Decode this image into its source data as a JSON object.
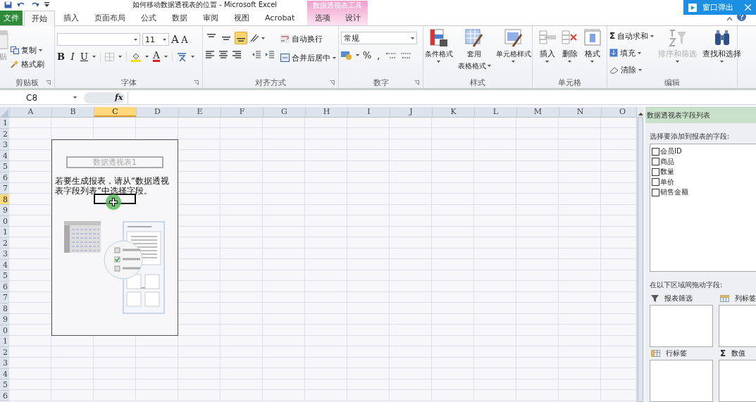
{
  "window": {
    "title": "如何移动数据透视表的位置 - Microsoft Excel"
  },
  "popout_button": {
    "label": "窗口弹出"
  },
  "contextual_group": {
    "label": "数据透视表工具"
  },
  "tabs": [
    {
      "label": "文件",
      "kind": "file",
      "selected": false
    },
    {
      "label": "开始",
      "kind": "normal",
      "selected": true
    },
    {
      "label": "插入",
      "kind": "normal",
      "selected": false
    },
    {
      "label": "页面布局",
      "kind": "normal",
      "selected": false
    },
    {
      "label": "公式",
      "kind": "normal",
      "selected": false
    },
    {
      "label": "数据",
      "kind": "normal",
      "selected": false
    },
    {
      "label": "审阅",
      "kind": "normal",
      "selected": false
    },
    {
      "label": "视图",
      "kind": "normal",
      "selected": false
    },
    {
      "label": "Acrobat",
      "kind": "normal",
      "selected": false
    },
    {
      "label": "选项",
      "kind": "contextual",
      "selected": false
    },
    {
      "label": "设计",
      "kind": "contextual",
      "selected": false
    }
  ],
  "ribbon": {
    "clipboard": {
      "label": "剪贴板",
      "paste": {
        "label": "贴",
        "disabled": true
      },
      "copy": "复制",
      "format_painter": "格式刷"
    },
    "font": {
      "label": "字体",
      "size": "11",
      "grow": "A",
      "shrink": "A",
      "bold": "B",
      "italic": "I",
      "underline": "U",
      "font_color": "A"
    },
    "alignment": {
      "label": "对齐方式",
      "vertical": [
        {
          "selected": false
        },
        {
          "selected": false
        },
        {
          "selected": true
        }
      ],
      "wrap_text": "自动换行",
      "merge_center": "合并后居中"
    },
    "number": {
      "label": "数字",
      "format": "常规",
      "percent": "%",
      "comma": ","
    },
    "styles": {
      "label": "样式",
      "buttons": [
        {
          "lines": [
            "条件格式"
          ],
          "kind": "conditional"
        },
        {
          "lines": [
            "套用",
            "表格格式"
          ],
          "kind": "table"
        },
        {
          "lines": [
            "单元格样式"
          ],
          "kind": "cell"
        }
      ]
    },
    "cells": {
      "label": "单元格",
      "buttons": [
        {
          "label": "插入",
          "kind": "insert"
        },
        {
          "label": "删除",
          "kind": "delete"
        },
        {
          "label": "格式",
          "kind": "format"
        }
      ]
    },
    "editing": {
      "label": "编辑",
      "sigma": "Σ",
      "autosum": "自动求和",
      "fill": "填充",
      "clear": "清除",
      "sort_filter": {
        "label": "排序和筛选",
        "disabled": true
      },
      "find_select": {
        "label": "查找和选择",
        "disabled": false
      }
    }
  },
  "formula_bar": {
    "name_box": "C8",
    "function_label": "fx"
  },
  "sheet": {
    "columns": [
      {
        "label": "A",
        "selected": false
      },
      {
        "label": "B",
        "selected": false
      },
      {
        "label": "C",
        "selected": true
      },
      {
        "label": "D",
        "selected": false
      },
      {
        "label": "E",
        "selected": false
      },
      {
        "label": "F",
        "selected": false
      },
      {
        "label": "G",
        "selected": false
      },
      {
        "label": "H",
        "selected": false
      },
      {
        "label": "I",
        "selected": false
      },
      {
        "label": "J",
        "selected": false
      },
      {
        "label": "K",
        "selected": false
      },
      {
        "label": "L",
        "selected": false
      },
      {
        "label": "M",
        "selected": false
      },
      {
        "label": "N",
        "selected": false
      },
      {
        "label": "O",
        "selected": false
      }
    ],
    "rows": [
      {
        "label": "1",
        "selected": false
      },
      {
        "label": "2",
        "selected": false
      },
      {
        "label": "3",
        "selected": false
      },
      {
        "label": "4",
        "selected": false
      },
      {
        "label": "5",
        "selected": false
      },
      {
        "label": "6",
        "selected": false
      },
      {
        "label": "7",
        "selected": false
      },
      {
        "label": "8",
        "selected": true
      },
      {
        "label": "9",
        "selected": false
      },
      {
        "label": "0",
        "selected": false
      },
      {
        "label": "1",
        "selected": false
      },
      {
        "label": "2",
        "selected": false
      },
      {
        "label": "3",
        "selected": false
      },
      {
        "label": "4",
        "selected": false
      },
      {
        "label": "5",
        "selected": false
      },
      {
        "label": "6",
        "selected": false
      },
      {
        "label": "7",
        "selected": false
      },
      {
        "label": "8",
        "selected": false
      },
      {
        "label": "9",
        "selected": false
      },
      {
        "label": "0",
        "selected": false
      },
      {
        "label": "1",
        "selected": false
      },
      {
        "label": "2",
        "selected": false
      },
      {
        "label": "3",
        "selected": false
      },
      {
        "label": "4",
        "selected": false
      },
      {
        "label": "5",
        "selected": false
      },
      {
        "label": "6",
        "selected": false
      }
    ],
    "pivot_placeholder": {
      "title": "数据透视表1",
      "message": "若要生成报表，请从“数据透视表字段列表”中选择字段。"
    }
  },
  "field_list": {
    "title": "数据透视表字段列表",
    "prompt": "选择要添加到报表的字段:",
    "fields": [
      {
        "label": "会员ID",
        "checked": false
      },
      {
        "label": "商品",
        "checked": false
      },
      {
        "label": "数量",
        "checked": false
      },
      {
        "label": "单价",
        "checked": false
      },
      {
        "label": "销售金额",
        "checked": false
      }
    ],
    "areas_prompt": "在以下区域间拖动字段:",
    "areas": [
      {
        "label": "报表筛选",
        "kind": "filter"
      },
      {
        "label": "列标签",
        "kind": "columns"
      },
      {
        "label": "行标签",
        "kind": "rows"
      },
      {
        "label": "数值",
        "kind": "values",
        "symbol": "Σ"
      }
    ]
  }
}
